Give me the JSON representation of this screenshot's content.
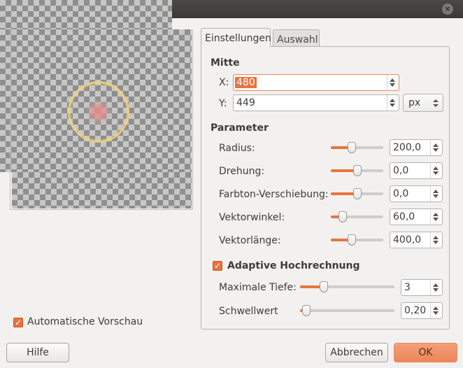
{
  "window": {
    "close_glyph": "×"
  },
  "tabs": [
    {
      "label": "Einstellungen",
      "active": true
    },
    {
      "label": "Auswahl",
      "active": false
    }
  ],
  "mitte": {
    "title": "Mitte",
    "x_label": "X:",
    "x_value": "480",
    "y_label": "Y:",
    "y_value": "449",
    "unit": "px"
  },
  "parameter": {
    "title": "Parameter",
    "rows": [
      {
        "label": "Radius:",
        "value": "200,0",
        "fraction": 0.4
      },
      {
        "label": "Drehung:",
        "value": "0,0",
        "fraction": 0.5
      },
      {
        "label": "Farbton-Verschiebung:",
        "value": "0,0",
        "fraction": 0.5
      },
      {
        "label": "Vektorwinkel:",
        "value": "60,0",
        "fraction": 0.22
      },
      {
        "label": "Vektorlänge:",
        "value": "400,0",
        "fraction": 0.4
      }
    ]
  },
  "adaptive": {
    "label": "Adaptive Hochrechnung",
    "checked": true,
    "rows": [
      {
        "label": "Maximale Tiefe:",
        "value": "3",
        "fraction": 0.25
      },
      {
        "label": "Schwellwert",
        "value": "0,20",
        "fraction": 0.07
      }
    ]
  },
  "preview": {
    "label": "Automatische Vorschau",
    "checked": true
  },
  "buttons": {
    "help": "Hilfe",
    "cancel": "Abbrechen",
    "ok": "OK"
  },
  "colors": {
    "accent": "#e9733e",
    "window_bg": "#f2f1f0",
    "titlebar": "#3c3b37"
  }
}
